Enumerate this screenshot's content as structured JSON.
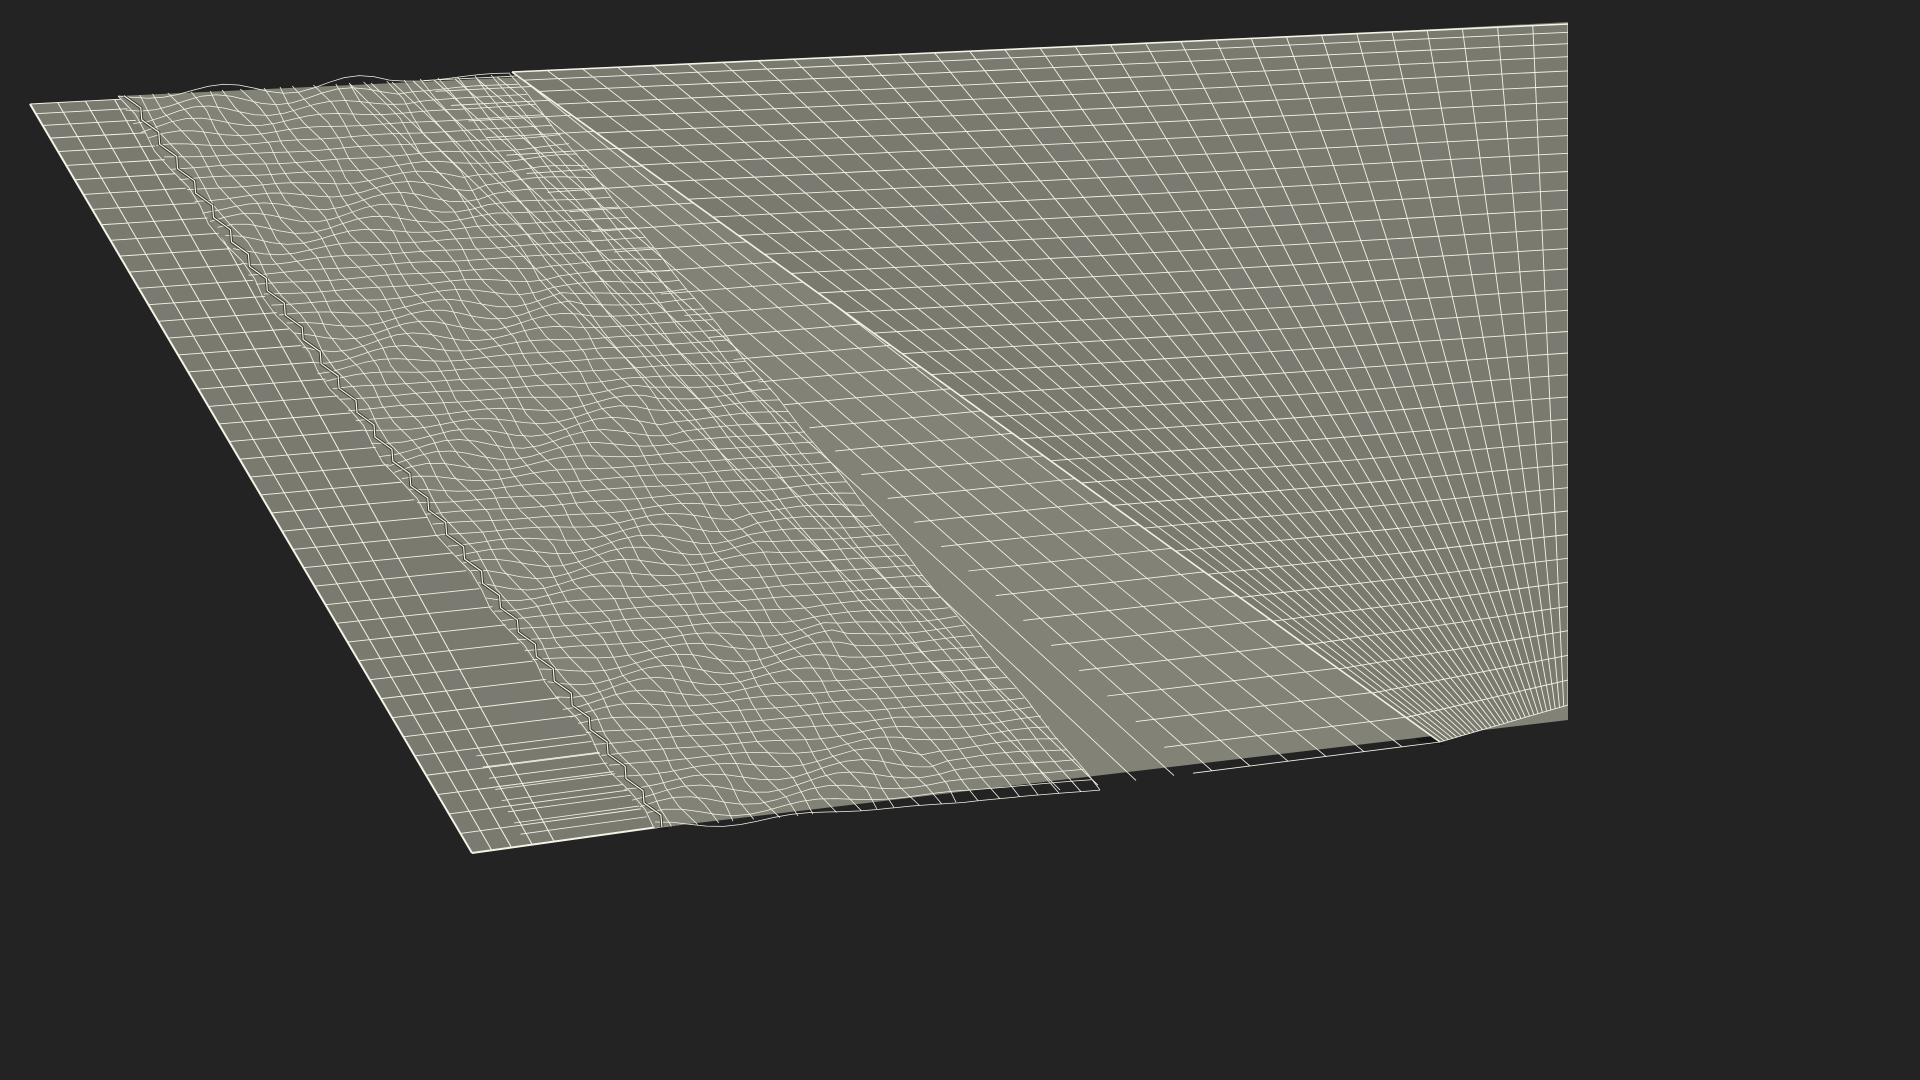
{
  "scene": {
    "colors": {
      "background": "#232323",
      "surface": "#7a7a70",
      "surface_light": "#828277",
      "surface_dark": "#6f6f66",
      "shadow": "#161616",
      "wire": "#f4f3e6"
    }
  }
}
